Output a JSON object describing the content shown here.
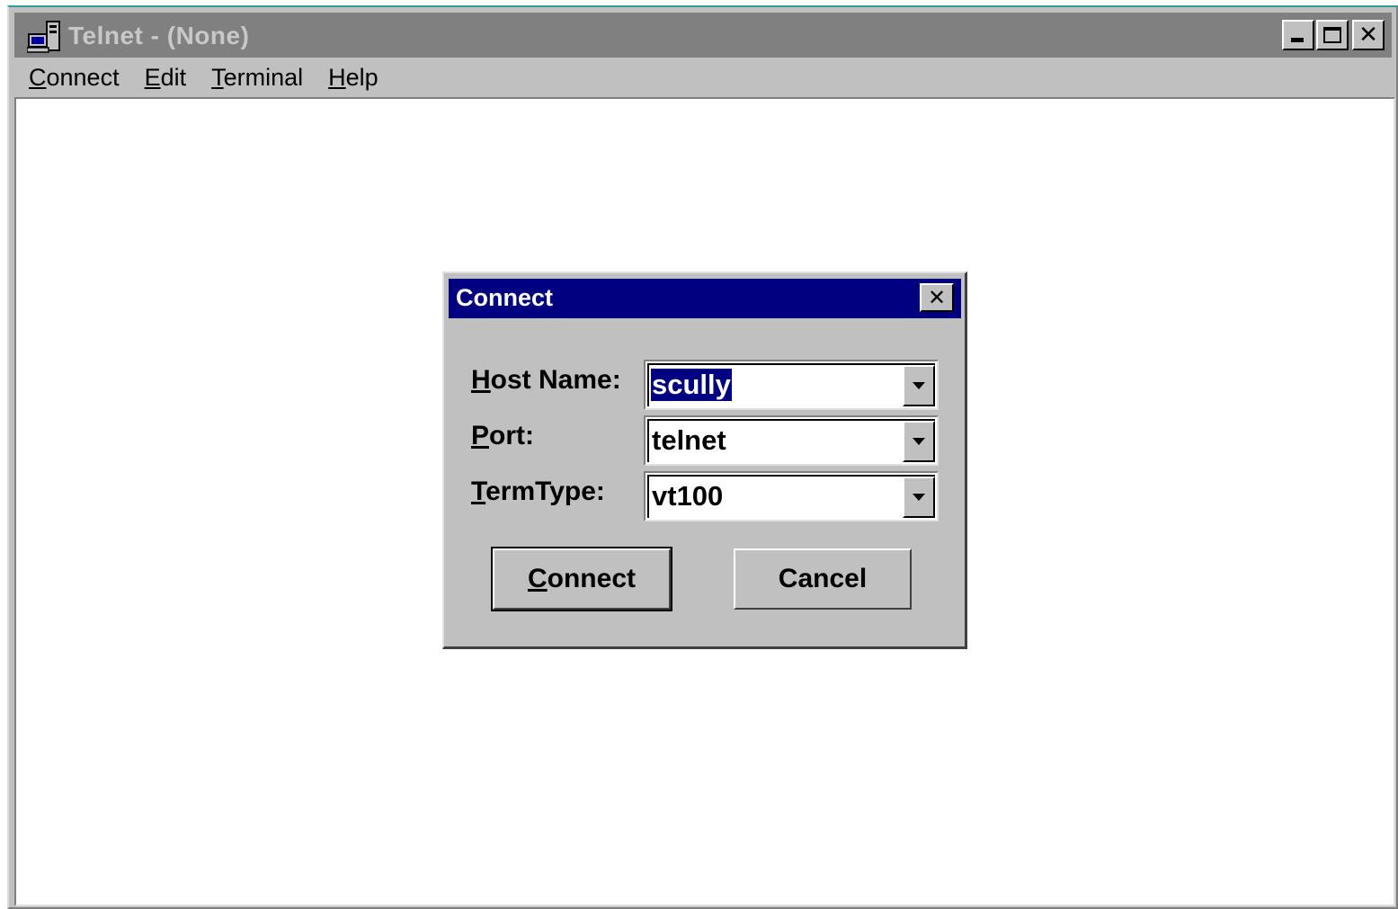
{
  "window": {
    "title": "Telnet - (None)",
    "icon": "telnet-computer-icon"
  },
  "menubar": {
    "items": [
      {
        "label": "Connect",
        "mnemonic": "C"
      },
      {
        "label": "Edit",
        "mnemonic": "E"
      },
      {
        "label": "Terminal",
        "mnemonic": "T"
      },
      {
        "label": "Help",
        "mnemonic": "H"
      }
    ]
  },
  "dialog": {
    "title": "Connect",
    "fields": [
      {
        "label": "Host Name:",
        "value": "scully",
        "selected": true
      },
      {
        "label": "Port:",
        "value": "telnet",
        "selected": false
      },
      {
        "label": "TermType:",
        "value": "vt100",
        "selected": false
      }
    ],
    "buttons": {
      "connect_label": "Connect",
      "cancel_label": "Cancel"
    }
  },
  "colors": {
    "dialog_title_bg": "#000080",
    "inactive_title_bg": "#808080",
    "face": "#c0c0c0",
    "selection_bg": "#000080"
  }
}
